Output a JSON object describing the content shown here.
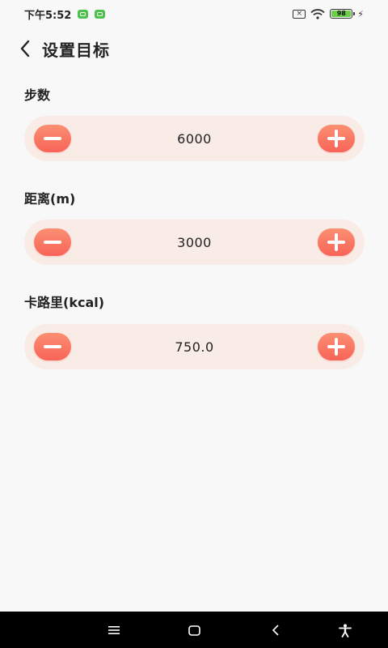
{
  "status_bar": {
    "time": "下午5:52",
    "battery_level": "98",
    "icons": [
      "notification-app-icon",
      "notification-app-icon",
      "no-sim-icon",
      "wifi-icon",
      "battery-icon",
      "charging-icon"
    ]
  },
  "header": {
    "back_icon": "chevron-left-icon",
    "title": "设置目标"
  },
  "goals": [
    {
      "label": "步数",
      "value": "6000"
    },
    {
      "label": "距离(m)",
      "value": "3000"
    },
    {
      "label": "卡路里(kcal)",
      "value": "750.0"
    }
  ],
  "colors": {
    "accent_gradient_top": "#fb8f72",
    "accent_gradient_bottom": "#f86458",
    "stepper_background": "#f9ece7",
    "page_background": "#f8f8f8",
    "nav_bar": "#000000"
  },
  "nav_bar": {
    "icons": [
      "menu-icon",
      "home-icon",
      "back-icon",
      "accessibility-icon"
    ]
  }
}
